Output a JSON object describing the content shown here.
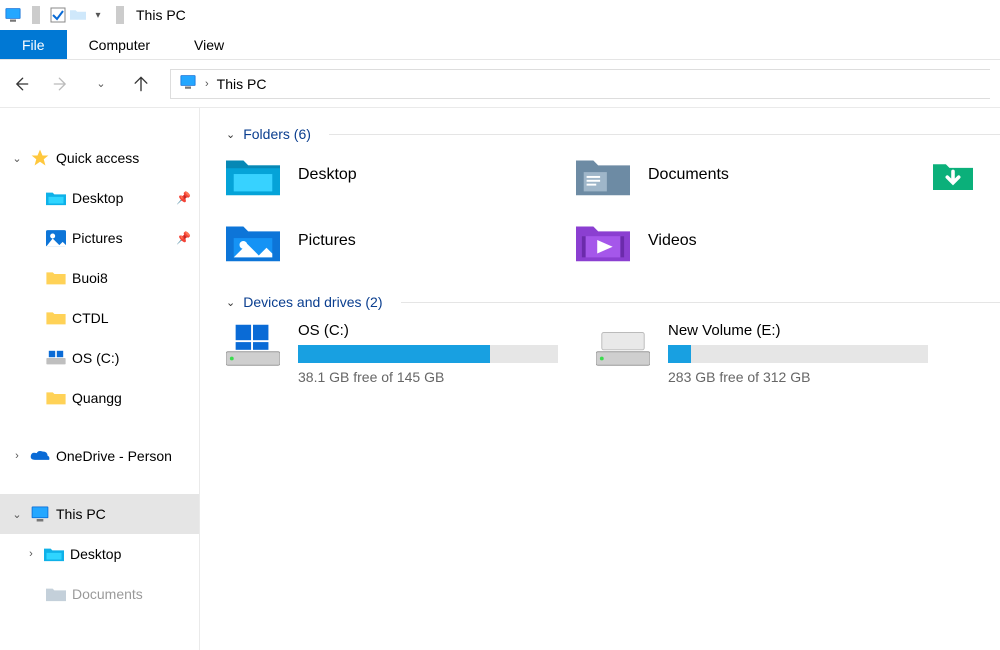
{
  "window": {
    "title": "This PC"
  },
  "ribbon": {
    "file": "File",
    "computer": "Computer",
    "view": "View"
  },
  "breadcrumb": {
    "location": "This PC"
  },
  "sidebar": {
    "quick_access": {
      "label": "Quick access",
      "items": [
        {
          "label": "Desktop",
          "pinned": true
        },
        {
          "label": "Pictures",
          "pinned": true
        },
        {
          "label": "Buoi8",
          "pinned": false
        },
        {
          "label": "CTDL",
          "pinned": false
        },
        {
          "label": "OS (C:)",
          "pinned": false
        },
        {
          "label": "Quangg",
          "pinned": false
        }
      ]
    },
    "onedrive": {
      "label": "OneDrive - Person"
    },
    "this_pc": {
      "label": "This PC",
      "children": [
        {
          "label": "Desktop"
        },
        {
          "label": "Documents"
        }
      ]
    }
  },
  "content": {
    "folders_header": "Folders (6)",
    "folders": [
      {
        "label": "Desktop"
      },
      {
        "label": "Documents"
      },
      {
        "label": "Downloads"
      },
      {
        "label": "Pictures"
      },
      {
        "label": "Videos"
      }
    ],
    "drives_header": "Devices and drives (2)",
    "drives": [
      {
        "name": "OS (C:)",
        "free": "38.1 GB free of 145 GB",
        "fill_pct": 74
      },
      {
        "name": "New Volume (E:)",
        "free": "283 GB free of 312 GB",
        "fill_pct": 9
      }
    ]
  }
}
